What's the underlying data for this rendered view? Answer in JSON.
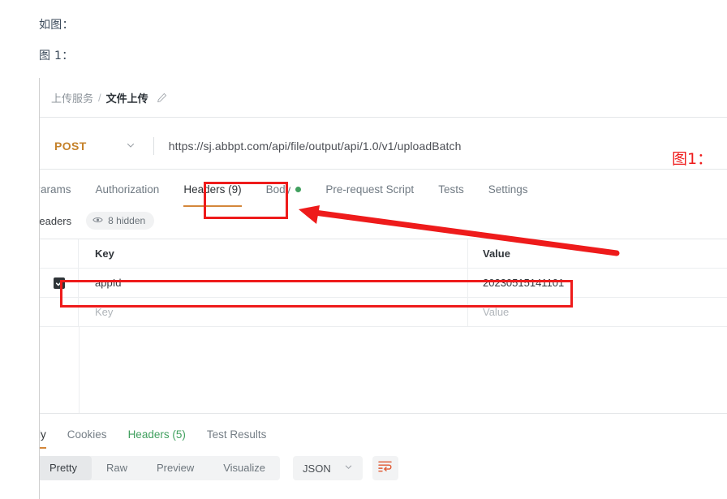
{
  "document": {
    "line_1": "如图：",
    "line_2": "图 1："
  },
  "annotations": {
    "figure_label": "图1：",
    "box_headers_tab": "highlight-headers-tab",
    "box_header_row": "highlight-appid-row",
    "arrow": "arrow-pointing-to-headers-tab",
    "color": "#ee1b1b"
  },
  "screenshot": {
    "breadcrumb": {
      "parent": "上传服务",
      "separator": "/",
      "current": "文件上传",
      "edit_icon": "pencil-icon"
    },
    "url_bar": {
      "method": "POST",
      "method_color": "#c5822b",
      "caret_icon": "chevron-down-icon",
      "url": "https://sj.abbpt.com/api/file/output/api/1.0/v1/uploadBatch"
    },
    "request_tabs": [
      {
        "label": "Params",
        "active": false
      },
      {
        "label": "Authorization",
        "active": false
      },
      {
        "label": "Headers (9)",
        "active": true
      },
      {
        "label": "Body",
        "active": false,
        "dot": true,
        "dot_color": "#41a05f"
      },
      {
        "label": "Pre-request Script",
        "active": false
      },
      {
        "label": "Tests",
        "active": false
      },
      {
        "label": "Settings",
        "active": false
      }
    ],
    "headers_section": {
      "title": "Headers",
      "hidden_icon": "eye-icon",
      "hidden_label": "8 hidden"
    },
    "table": {
      "columns": {
        "key": "Key",
        "value": "Value"
      },
      "rows": [
        {
          "checked": true,
          "key": "appId",
          "value": "20230515141101"
        }
      ],
      "placeholder_row": {
        "key": "Key",
        "value": "Value"
      }
    },
    "response_tabs": [
      {
        "label": "ody",
        "active": true
      },
      {
        "label": "Cookies",
        "active": false
      },
      {
        "label": "Headers (5)",
        "active": false,
        "count_color": "#41a05f"
      },
      {
        "label": "Test Results",
        "active": false
      }
    ],
    "response_toolbar": {
      "segments": [
        {
          "label": "Pretty",
          "active": true
        },
        {
          "label": "Raw",
          "active": false
        },
        {
          "label": "Preview",
          "active": false
        },
        {
          "label": "Visualize",
          "active": false
        }
      ],
      "format": "JSON",
      "format_caret": "chevron-down-icon",
      "wrap_icon": "wrap-text-icon"
    }
  }
}
